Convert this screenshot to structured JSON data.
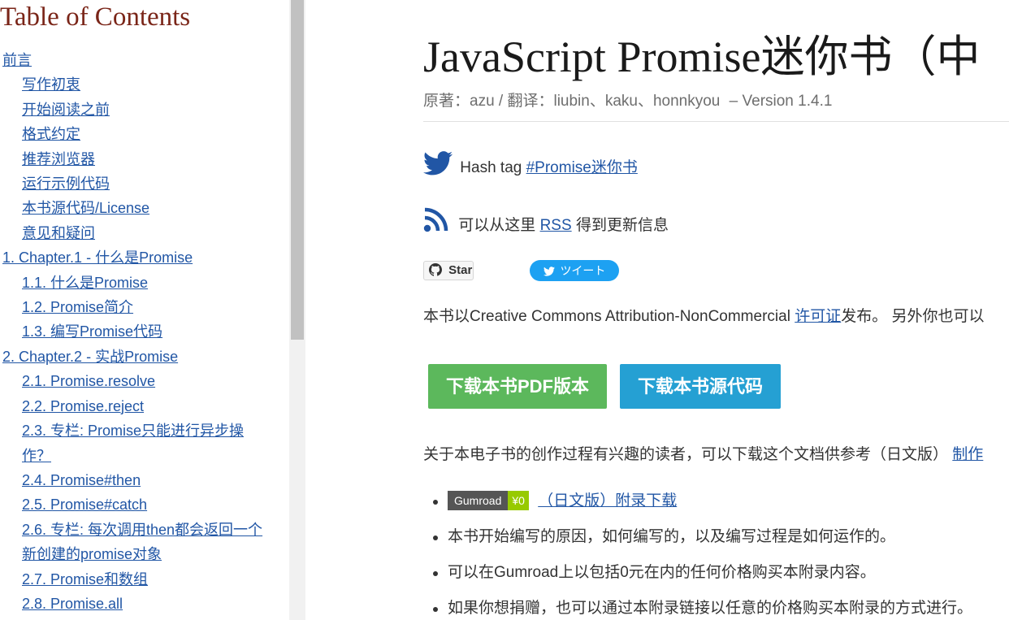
{
  "toc": {
    "title": "Table of Contents",
    "items": [
      {
        "label": "前言"
      },
      {
        "label": "写作初衷"
      },
      {
        "label": "开始阅读之前"
      },
      {
        "label": "格式约定"
      },
      {
        "label": "推荐浏览器"
      },
      {
        "label": "运行示例代码"
      },
      {
        "label": "本书源代码/License"
      },
      {
        "label": "意见和疑问"
      },
      {
        "label": "1. Chapter.1 - 什么是Promise"
      },
      {
        "label": "1.1. 什么是Promise"
      },
      {
        "label": "1.2. Promise简介"
      },
      {
        "label": "1.3. 编写Promise代码"
      },
      {
        "label": "2. Chapter.2 - 实战Promise"
      },
      {
        "label": "2.1. Promise.resolve"
      },
      {
        "label": "2.2. Promise.reject"
      },
      {
        "label": "2.3. 专栏: Promise只能进行异步操作？"
      },
      {
        "label": "2.4. Promise#then"
      },
      {
        "label": "2.5. Promise#catch"
      },
      {
        "label": "2.6. 专栏: 每次调用then都会返回一个新创建的promise对象"
      },
      {
        "label": "2.7. Promise和数组"
      },
      {
        "label": "2.8. Promise.all"
      }
    ]
  },
  "main": {
    "title": "JavaScript Promise迷你书（中",
    "meta": {
      "authors": "原著：azu / 翻译：liubin、kaku、honnkyou",
      "version": "– Version 1.4.1"
    },
    "hashtag": {
      "prefix": "Hash tag",
      "tag": "#Promise迷你书"
    },
    "rss": {
      "prefix": "可以从这里",
      "link": "RSS",
      "suffix": "得到更新信息"
    },
    "star_button": "Star",
    "tweet_button": "ツイート",
    "license": {
      "prefix": "本书以Creative Commons Attribution-NonCommercial",
      "link": "许可证",
      "suffix": "发布。 另外你也可以"
    },
    "download_pdf": "下载本书PDF版本",
    "download_source": "下载本书源代码",
    "intro": {
      "text": "关于本电子书的创作过程有兴趣的读者，可以下载这个文档供参考（日文版）",
      "link": "制作"
    },
    "bullets": {
      "gumroad_name": "Gumroad",
      "gumroad_price": "¥0",
      "appendix_link": "（日文版）附录下载",
      "item2": "本书开始编写的原因，如何编写的，以及编写过程是如何运作的。",
      "item3": "可以在Gumroad上以包括0元在内的任何价格购买本附录内容。",
      "item4": "如果你想捐赠，也可以通过本附录链接以任意的价格购买本附录的方式进行。"
    }
  },
  "colors": {
    "toc_title": "#7a2518",
    "link": "#2156a5",
    "pdf_button": "#5cb85c",
    "source_button": "#25a0d3",
    "tweet_button": "#1da1f2",
    "gumroad_badge": "#555555",
    "price_badge": "#97ca00"
  },
  "icons": {
    "twitter": "twitter-bird-icon",
    "rss": "rss-icon",
    "github": "github-octocat-icon"
  }
}
